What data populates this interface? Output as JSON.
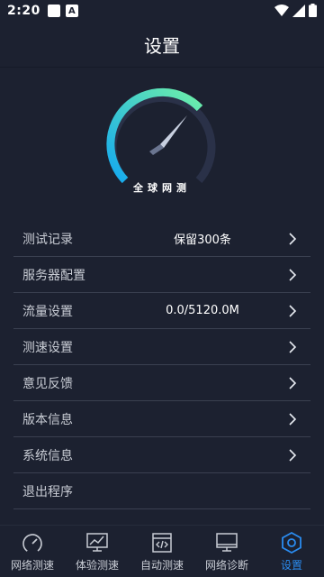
{
  "status_bar": {
    "time": "2:20",
    "a_icon": "A"
  },
  "header": {
    "title": "设置"
  },
  "gauge": {
    "caption": "全球网测",
    "arc_color_start": "#14a8f0",
    "arc_color_end": "#6ef0a8"
  },
  "menu": {
    "items": [
      {
        "label": "测试记录",
        "value": "保留300条",
        "chevron": true
      },
      {
        "label": "服务器配置",
        "value": "",
        "chevron": true
      },
      {
        "label": "流量设置",
        "value": "0.0/5120.0M",
        "chevron": true
      },
      {
        "label": "测速设置",
        "value": "",
        "chevron": true
      },
      {
        "label": "意见反馈",
        "value": "",
        "chevron": true
      },
      {
        "label": "版本信息",
        "value": "",
        "chevron": true
      },
      {
        "label": "系统信息",
        "value": "",
        "chevron": true
      },
      {
        "label": "退出程序",
        "value": "",
        "chevron": false
      }
    ]
  },
  "tabbar": {
    "active_color": "#2a8cf0",
    "tabs": [
      {
        "label": "网络测速",
        "icon": "speedometer-icon"
      },
      {
        "label": "体验测速",
        "icon": "monitor-chart-icon"
      },
      {
        "label": "自动测速",
        "icon": "code-window-icon"
      },
      {
        "label": "网络诊断",
        "icon": "monitor-icon"
      },
      {
        "label": "设置",
        "icon": "hexagon-settings-icon",
        "active": true
      }
    ]
  }
}
